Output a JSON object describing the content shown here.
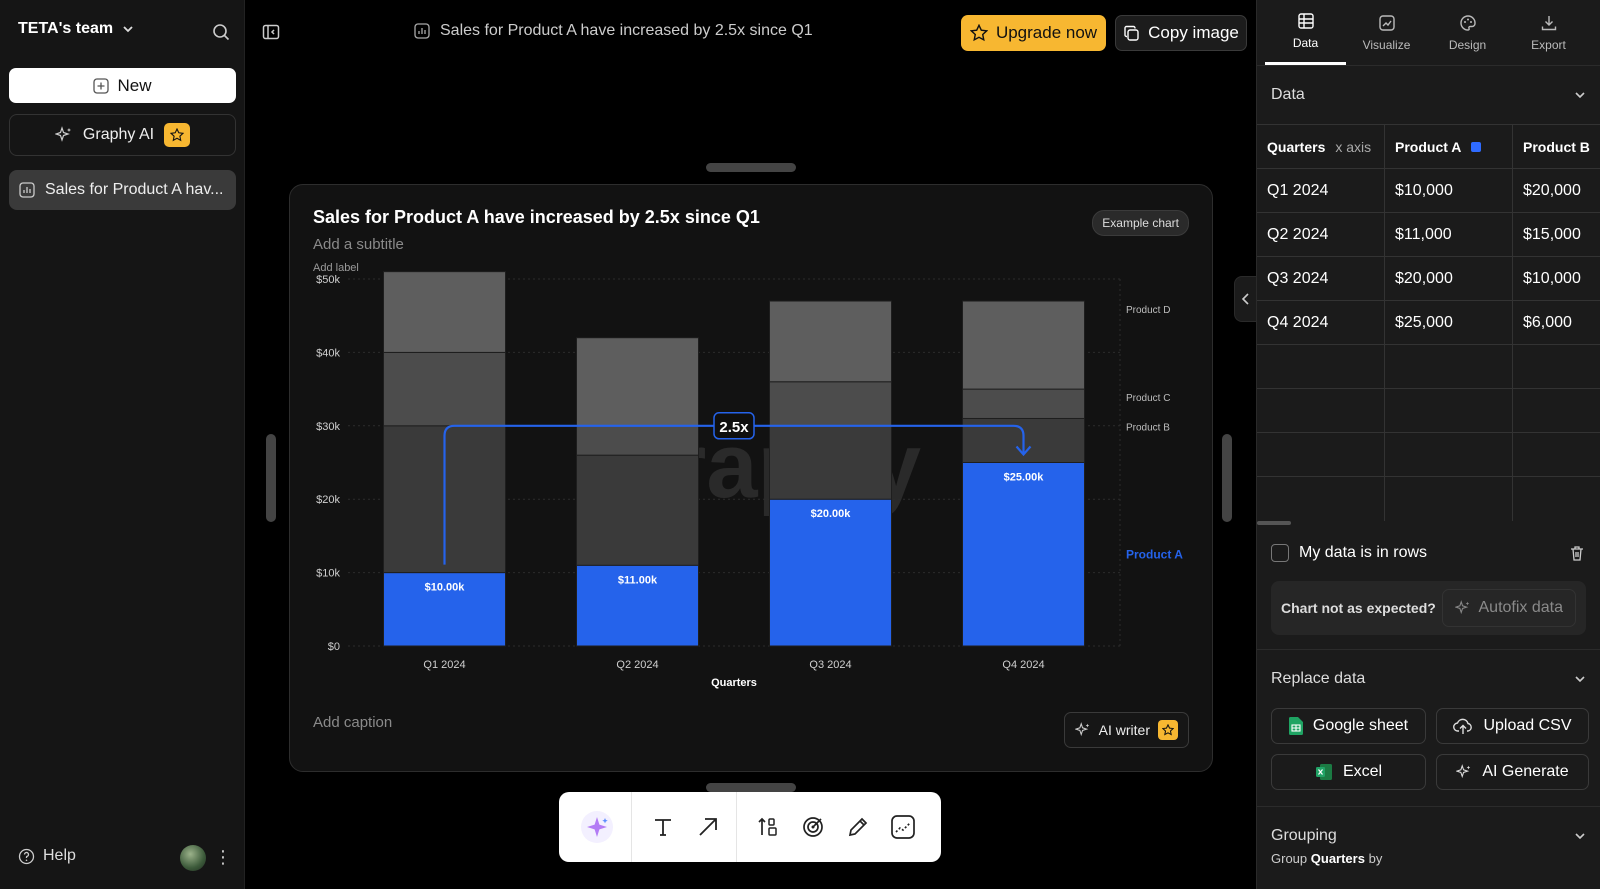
{
  "sidebar": {
    "team_name": "TETA's team",
    "new_label": "New",
    "graphy_ai_label": "Graphy AI",
    "doc_item_label": "Sales for Product A hav...",
    "help_label": "Help"
  },
  "topbar": {
    "doc_title": "Sales for Product A have increased by 2.5x since Q1",
    "upgrade_label": "Upgrade now",
    "copy_label": "Copy image"
  },
  "card": {
    "title": "Sales for Product A have increased by 2.5x since Q1",
    "subtitle_placeholder": "Add a subtitle",
    "label_placeholder": "Add label",
    "example_badge": "Example chart",
    "caption_placeholder": "Add caption",
    "ai_writer_label": "AI writer",
    "watermark": "Graphy"
  },
  "chart_data": {
    "type": "bar",
    "stacked": true,
    "xlabel": "Quarters",
    "ylim": [
      0,
      50000
    ],
    "yticks": [
      0,
      10000,
      20000,
      30000,
      40000,
      50000
    ],
    "ytick_labels": [
      "$0",
      "$10k",
      "$20k",
      "$30k",
      "$40k",
      "$50k"
    ],
    "categories": [
      "Q1 2024",
      "Q2 2024",
      "Q3 2024",
      "Q4 2024"
    ],
    "series": [
      {
        "name": "Product A",
        "values": [
          10000,
          11000,
          20000,
          25000
        ],
        "color": "#2563eb",
        "data_labels": [
          "$10.00k",
          "$11.00k",
          "$20.00k",
          "$25.00k"
        ]
      },
      {
        "name": "Product B",
        "values": [
          20000,
          15000,
          10000,
          6000
        ],
        "color": "#3a3a3a"
      },
      {
        "name": "Product C",
        "values": [
          10000,
          4000,
          6000,
          4000
        ],
        "color": "#4c4c4c"
      },
      {
        "name": "Product D",
        "values": [
          11000,
          12000,
          11000,
          12000
        ],
        "color": "#5e5e5e"
      }
    ],
    "annotation": {
      "label": "2.5x",
      "from_category": "Q1 2024",
      "to_category": "Q4 2024",
      "level": 30000,
      "color": "#2563eb"
    },
    "legend": "right"
  },
  "canvas_toolbar": {
    "tools": [
      "ai-sparkle-icon",
      "text-icon",
      "arrow-icon",
      "sort-icon",
      "target-icon",
      "pen-icon",
      "trend-icon"
    ]
  },
  "right_panel": {
    "tabs": [
      {
        "label": "Data",
        "icon": "table-icon",
        "active": true
      },
      {
        "label": "Visualize",
        "icon": "chart-icon",
        "active": false
      },
      {
        "label": "Design",
        "icon": "palette-icon",
        "active": false
      },
      {
        "label": "Export",
        "icon": "download-icon",
        "active": false
      }
    ],
    "data_section_title": "Data",
    "table": {
      "headers": [
        "Quarters",
        "Product A",
        "Product B"
      ],
      "x_axis_tag": "x axis",
      "rows": [
        [
          "Q1 2024",
          "$10,000",
          "$20,000"
        ],
        [
          "Q2 2024",
          "$11,000",
          "$15,000"
        ],
        [
          "Q3 2024",
          "$20,000",
          "$10,000"
        ],
        [
          "Q4 2024",
          "$25,000",
          "$6,000"
        ]
      ]
    },
    "rows_checkbox_label": "My data is in rows",
    "autofix_prompt": "Chart not as expected?",
    "autofix_label": "Autofix data",
    "replace_title": "Replace data",
    "replace_buttons": {
      "google_sheet": "Google sheet",
      "upload_csv": "Upload CSV",
      "excel": "Excel",
      "ai_generate": "AI Generate"
    },
    "grouping_title": "Grouping",
    "group_prefix": "Group",
    "group_field": "Quarters",
    "group_suffix": "by"
  }
}
